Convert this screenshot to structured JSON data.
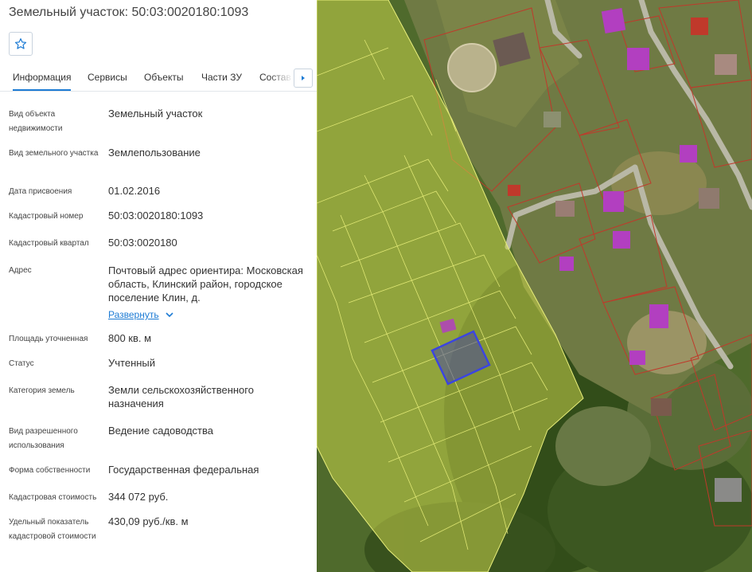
{
  "title": "Земельный участок: 50:03:0020180:1093",
  "tabs": [
    {
      "label": "Информация",
      "active": true
    },
    {
      "label": "Сервисы"
    },
    {
      "label": "Объекты"
    },
    {
      "label": "Части ЗУ"
    },
    {
      "label": "Состав Е"
    }
  ],
  "fields": {
    "object_type": {
      "label": "Вид объекта недвижимости",
      "value": "Земельный участок"
    },
    "plot_type": {
      "label": "Вид земельного участка",
      "value": "Землепользование"
    },
    "assign_date": {
      "label": "Дата присвоения",
      "value": "01.02.2016"
    },
    "cadastral_number": {
      "label": "Кадастровый номер",
      "value": "50:03:0020180:1093"
    },
    "cadastral_quarter": {
      "label": "Кадастровый квартал",
      "value": "50:03:0020180"
    },
    "address": {
      "label": "Адрес",
      "value": "Почтовый адрес ориентира: Московская область, Клинский район, городское поселение Клин, д."
    },
    "area": {
      "label": "Площадь уточненная",
      "value": "800 кв. м"
    },
    "status": {
      "label": "Статус",
      "value": "Учтенный"
    },
    "land_category": {
      "label": "Категория земель",
      "value": "Земли сельскохозяйственного назначения"
    },
    "permitted_use": {
      "label": "Вид разрешенного использования",
      "value": "Ведение садоводства"
    },
    "ownership": {
      "label": "Форма собственности",
      "value": "Государственная федеральная"
    },
    "cadastral_value": {
      "label": "Кадастровая стоимость",
      "value": "344 072 руб."
    },
    "specific_value": {
      "label": "Удельный показатель кадастровой стоимости",
      "value": "430,09 руб./кв. м"
    }
  },
  "expand_label": "Развернуть",
  "icons": {
    "favorite": "star-icon",
    "tab_scroll": "chevron-right-icon",
    "expand": "chevron-down-icon"
  },
  "colors": {
    "accent": "#1d7bd4",
    "parcel_fill": "#c8d44a",
    "parcel_border": "#e8ee7a",
    "selected_parcel": "#3b45e0",
    "building": "#b23fc0",
    "boundary_red": "#c0392b"
  }
}
